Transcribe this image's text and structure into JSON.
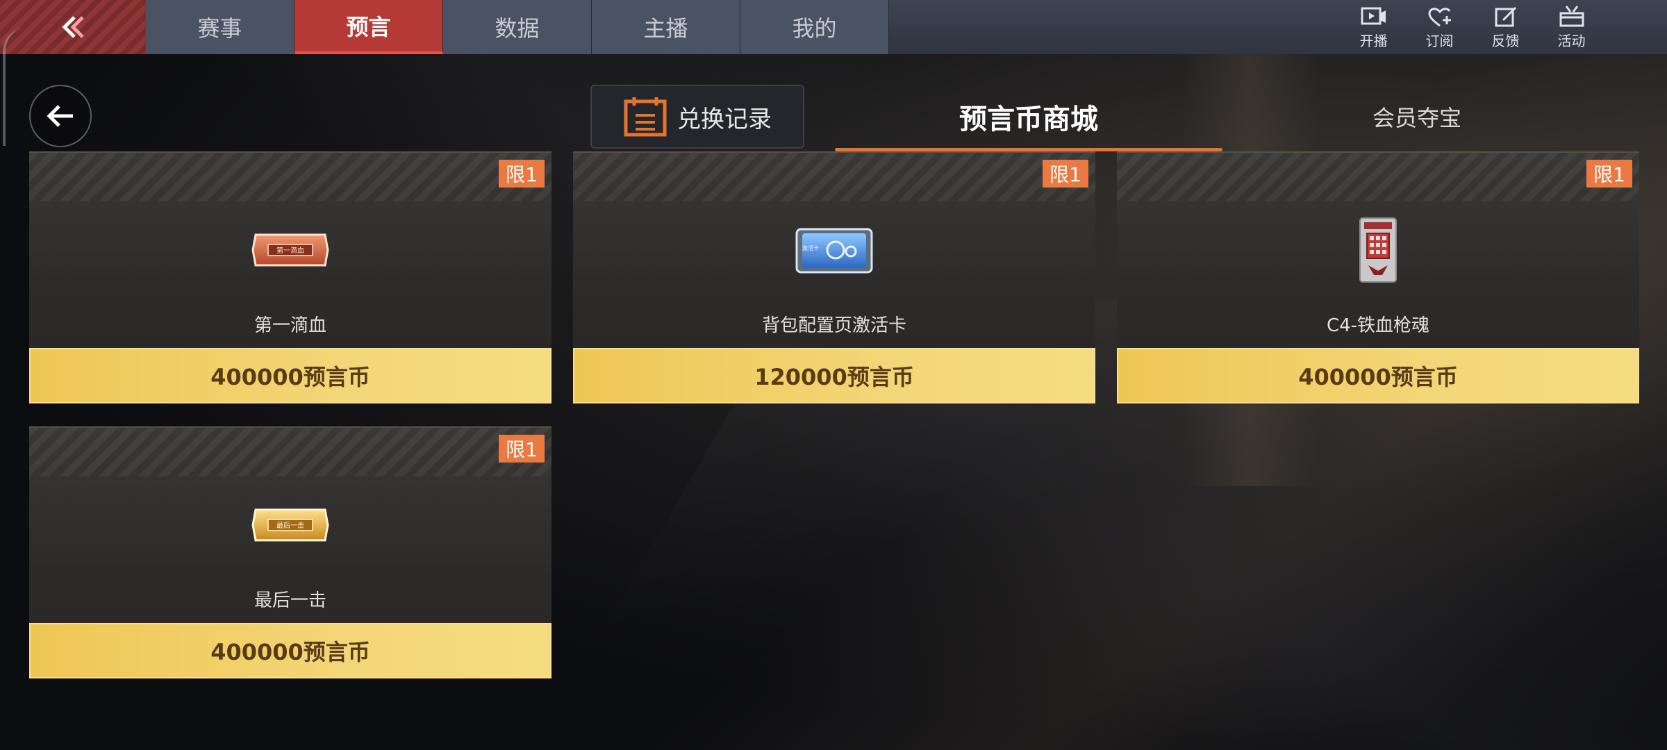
{
  "nav": {
    "tabs": [
      {
        "label": "赛事"
      },
      {
        "label": "预言"
      },
      {
        "label": "数据"
      },
      {
        "label": "主播"
      },
      {
        "label": "我的"
      }
    ],
    "active_index": 1,
    "actions": [
      {
        "label": "开播",
        "icon": "video-icon"
      },
      {
        "label": "订阅",
        "icon": "heart-plus-icon"
      },
      {
        "label": "反馈",
        "icon": "edit-icon"
      },
      {
        "label": "活动",
        "icon": "gift-icon"
      }
    ]
  },
  "header": {
    "exchange_label": "兑换记录",
    "shop_tabs": [
      {
        "label": "预言币商城",
        "active": true
      },
      {
        "label": "会员夺宝",
        "active": false
      }
    ]
  },
  "items": [
    {
      "name": "第一滴血",
      "price": "400000预言币",
      "badge": "限1",
      "icon": "first-blood-plate-icon",
      "icon_label": "第一滴血"
    },
    {
      "name": "背包配置页激活卡",
      "price": "120000预言币",
      "badge": "限1",
      "icon": "activation-card-icon",
      "icon_label": "激活卡"
    },
    {
      "name": "C4-铁血枪魂",
      "price": "400000预言币",
      "badge": "限1",
      "icon": "c4-bomb-icon"
    },
    {
      "name": "最后一击",
      "price": "400000预言币",
      "badge": "限1",
      "icon": "last-hit-plate-icon",
      "icon_label": "最后一击"
    }
  ],
  "colors": {
    "accent_red": "#b53a35",
    "accent_orange": "#e6732f",
    "badge": "#ea7a41",
    "price_gold": "#f3d678"
  }
}
